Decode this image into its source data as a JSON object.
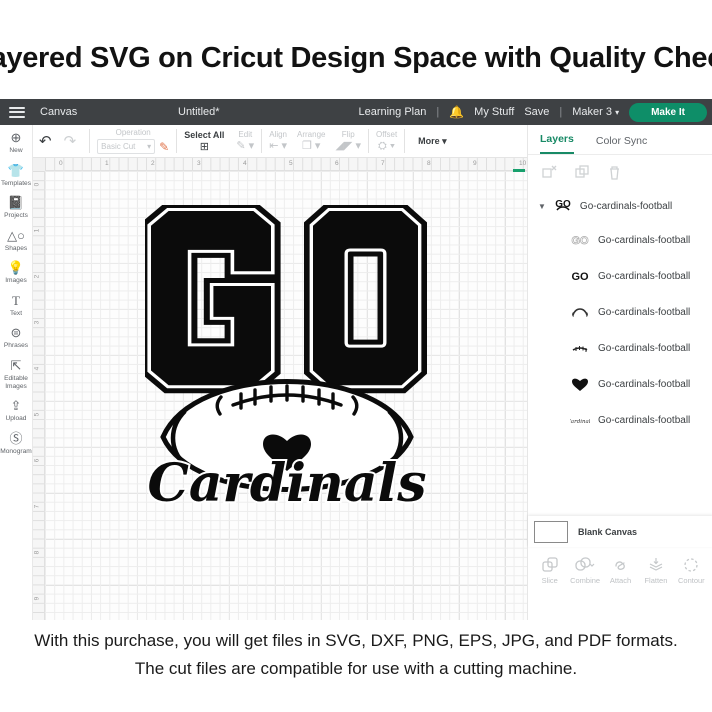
{
  "page": {
    "title": "Layered SVG on Cricut Design Space with Quality Check",
    "footer_line1": "With this purchase, you will get files in SVG, DXF, PNG, EPS, JPG, and PDF formats.",
    "footer_line2": "The cut files are compatible for use with a cutting machine."
  },
  "topnav": {
    "canvas_label": "Canvas",
    "document_title": "Untitled*",
    "learning_plan": "Learning Plan",
    "separator": "|",
    "my_stuff": "My Stuff",
    "save": "Save",
    "machine": "Maker 3",
    "make_it": "Make It",
    "accent_color": "#0e8e68"
  },
  "toolbar": {
    "operation_label": "Operation",
    "operation_value": "Basic Cut",
    "select_all": "Select All",
    "edit": "Edit",
    "align": "Align",
    "arrange": "Arrange",
    "flip": "Flip",
    "offset": "Offset",
    "more": "More ▾"
  },
  "sidebar": {
    "items": [
      {
        "label": "New"
      },
      {
        "label": "Templates"
      },
      {
        "label": "Projects"
      },
      {
        "label": "Shapes"
      },
      {
        "label": "Images"
      },
      {
        "label": "Text"
      },
      {
        "label": "Phrases"
      },
      {
        "label": "Editable Images"
      },
      {
        "label": "Upload"
      },
      {
        "label": "Monogram"
      }
    ]
  },
  "canvas": {
    "ruler_h": [
      "0",
      "1",
      "2",
      "3",
      "4",
      "5",
      "6",
      "7",
      "8",
      "9",
      "10"
    ],
    "ruler_v": [
      "0",
      "1",
      "2",
      "3",
      "4",
      "5",
      "6",
      "7",
      "8",
      "9"
    ],
    "design_text_go": "GO",
    "design_text_team": "Cardinals"
  },
  "layers_panel": {
    "tabs": [
      {
        "label": "Layers",
        "active": true
      },
      {
        "label": "Color Sync",
        "active": false
      }
    ],
    "group_label": "Go-cardinals-football",
    "items": [
      {
        "label": "Go-cardinals-football",
        "thumb": "go-outline"
      },
      {
        "label": "Go-cardinals-football",
        "thumb": "go-solid"
      },
      {
        "label": "Go-cardinals-football",
        "thumb": "football-outline"
      },
      {
        "label": "Go-cardinals-football",
        "thumb": "laces"
      },
      {
        "label": "Go-cardinals-football",
        "thumb": "heart"
      },
      {
        "label": "Go-cardinals-football",
        "thumb": "script"
      }
    ],
    "blank_canvas_label": "Blank Canvas",
    "actions": [
      "Slice",
      "Combine",
      "Attach",
      "Flatten",
      "Contour"
    ],
    "active_tab_color": "#188a66"
  }
}
